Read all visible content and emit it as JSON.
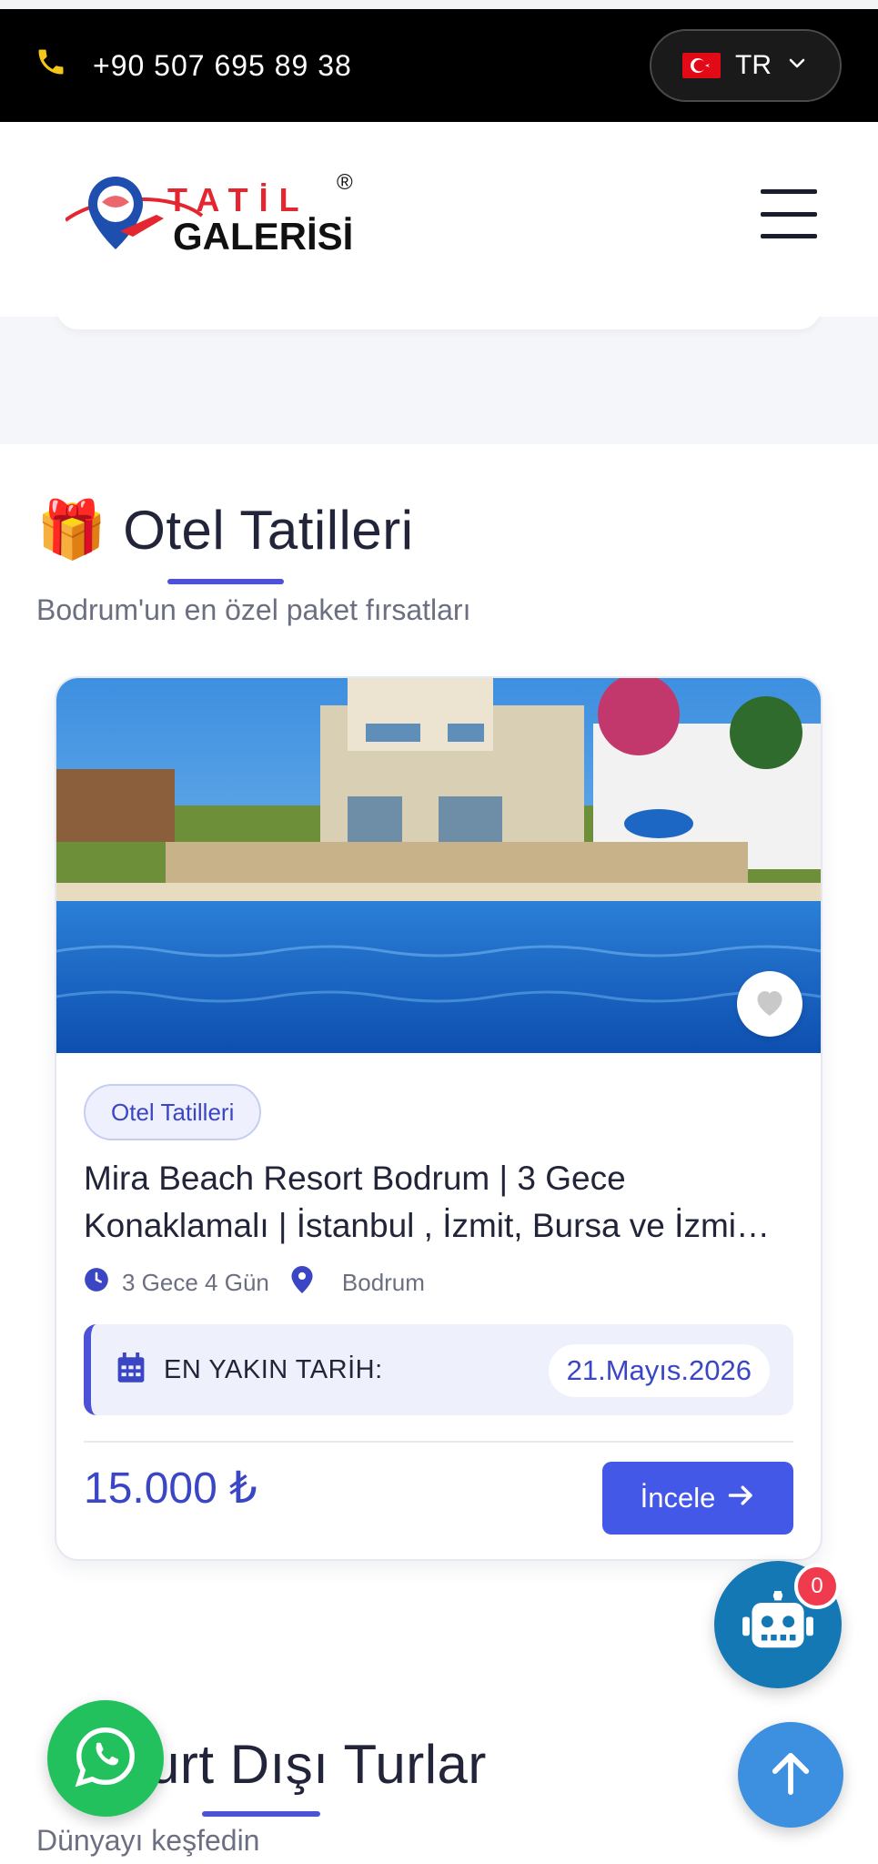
{
  "topbar": {
    "phone": "+90 507 695 89 38",
    "language": "TR"
  },
  "logo": {
    "line1": "TATİL",
    "line2": "GALERİSİ",
    "registered": "®"
  },
  "section1": {
    "emoji": "🎁",
    "title": "Otel Tatilleri",
    "subtitle": "Bodrum'un en özel paket fırsatları"
  },
  "card": {
    "category": "Otel Tatilleri",
    "title_line1": "Mira Beach Resort Bodrum | 3 Gece",
    "title_line2": "Konaklamalı | İstanbul , İzmit, Bursa ve İzmi…",
    "duration": "3 Gece 4 Gün",
    "location": "Bodrum",
    "date_label": "EN YAKIN TARİH:",
    "date_value": "21.Mayıs.2026",
    "price": "15.000 ₺",
    "cta": "İncele"
  },
  "chatbot": {
    "count": "0"
  },
  "section2": {
    "title": "urt Dışı Turlar",
    "subtitle": "Dünyayı keşfedin"
  },
  "colors": {
    "accent": "#4c51d8",
    "button": "#4458e8",
    "topbar": "#000000",
    "whatsapp": "#22c15e",
    "chatbot": "#1478b5",
    "scroll_top": "#3d8fe0"
  }
}
